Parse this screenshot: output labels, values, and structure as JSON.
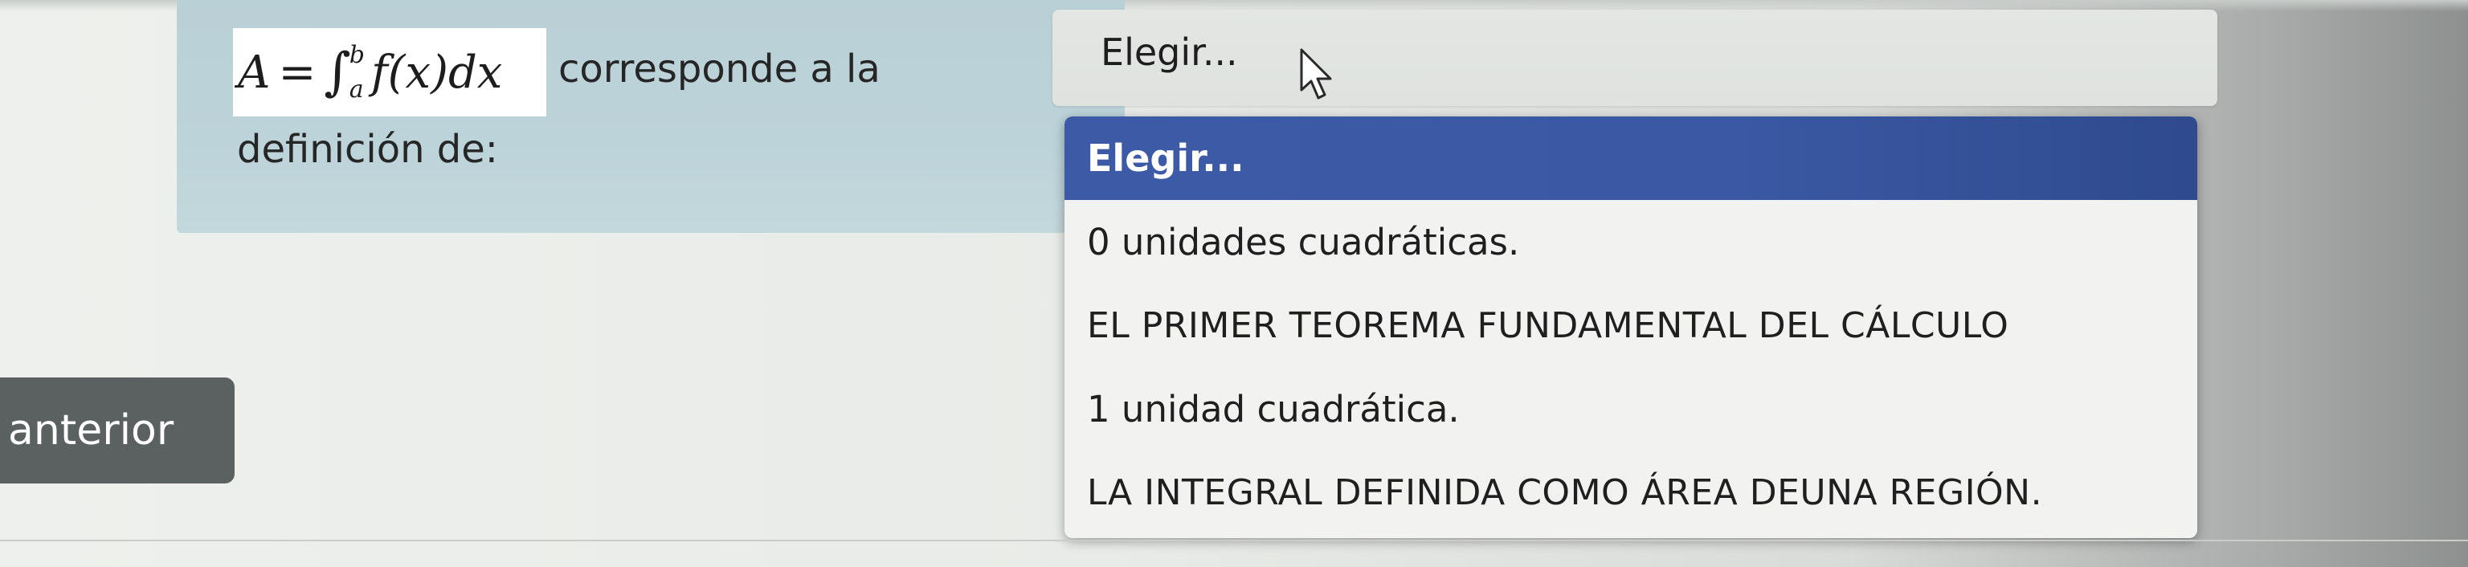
{
  "question": {
    "formula": {
      "lhs": "A",
      "equals": "=",
      "integral_sign": "∫",
      "upper_limit": "b",
      "lower_limit": "a",
      "integrand": "f(x)dx"
    },
    "text_after_formula": "corresponde a la",
    "text_line_2": "definición de:"
  },
  "select": {
    "current_value": "Elegir...",
    "options": [
      {
        "label": "Elegir...",
        "selected": true
      },
      {
        "label": "0 unidades cuadráticas.",
        "selected": false
      },
      {
        "label": "EL PRIMER TEOREMA FUNDAMENTAL DEL CÁLCULO",
        "selected": false
      },
      {
        "label": "1 unidad cuadrática.",
        "selected": false
      },
      {
        "label": "LA INTEGRAL DEFINIDA COMO ÁREA DEUNA REGIÓN.",
        "selected": false
      }
    ]
  },
  "navigation": {
    "previous_label": "anterior"
  },
  "colors": {
    "question_background": "#bcd3d9",
    "selected_option": "#3c5aa6",
    "previous_button": "#5b6060"
  },
  "icons": {
    "cursor": "arrow-pointer-icon"
  }
}
